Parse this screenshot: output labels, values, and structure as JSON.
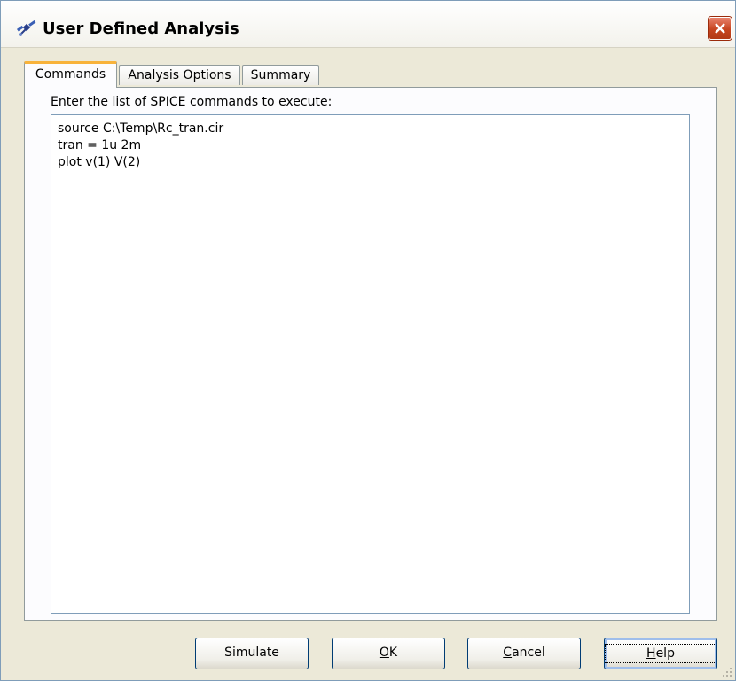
{
  "window": {
    "title": "User Defined Analysis"
  },
  "tabs": [
    {
      "label": "Commands",
      "active": true
    },
    {
      "label": "Analysis Options",
      "active": false
    },
    {
      "label": "Summary",
      "active": false
    }
  ],
  "commands_tab": {
    "prompt": "Enter the list of SPICE commands to execute:",
    "lines": [
      "source C:\\Temp\\Rc_tran.cir",
      "tran = 1u 2m",
      "plot v(1) V(2)"
    ]
  },
  "buttons": {
    "simulate": "Simulate",
    "ok_mnemonic": "O",
    "ok_rest": "K",
    "cancel_mnemonic": "C",
    "cancel_rest": "ancel",
    "help_mnemonic": "H",
    "help_rest": "elp"
  },
  "icons": {
    "app": "satellite-icon",
    "close": "close-icon"
  },
  "colors": {
    "close_button": "#c6441f",
    "active_tab_accent": "#f8b33b",
    "dialog_background": "#ece9d8"
  }
}
